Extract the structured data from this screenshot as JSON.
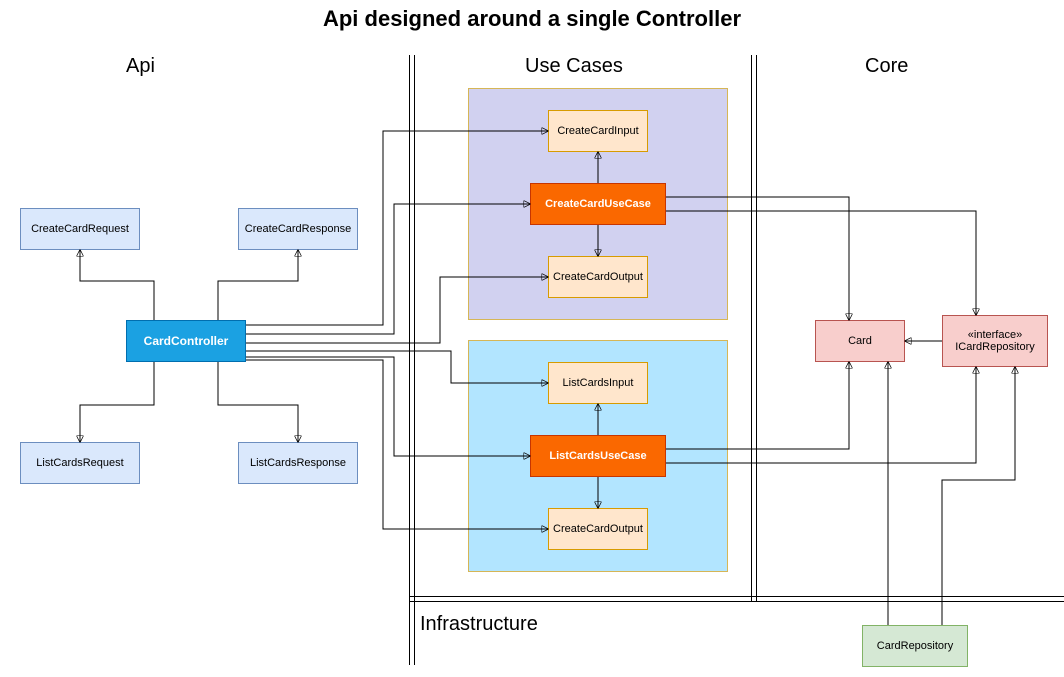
{
  "title": "Api designed around a single Controller",
  "sections": {
    "api": "Api",
    "usecases": "Use Cases",
    "core": "Core",
    "infra": "Infrastructure"
  },
  "boxes": {
    "create_card_request": "CreateCardRequest",
    "create_card_response": "CreateCardResponse",
    "list_cards_request": "ListCardsRequest",
    "list_cards_response": "ListCardsResponse",
    "card_controller": "CardController",
    "create_card_input": "CreateCardInput",
    "create_card_use_case": "CreateCardUseCase",
    "create_card_output1": "CreateCardOutput",
    "list_cards_input": "ListCardsInput",
    "list_cards_use_case": "ListCardsUseCase",
    "create_card_output2": "CreateCardOutput",
    "card": "Card",
    "icard_repository": "«interface»\nICardRepository",
    "card_repository": "CardRepository"
  },
  "colors": {
    "light_blue": "#dae8fc",
    "primary_blue": "#1ba1e2",
    "tan": "#ffe6cc",
    "orange": "#fa6800",
    "pink": "#f8cecc",
    "green": "#d5e8d4"
  }
}
